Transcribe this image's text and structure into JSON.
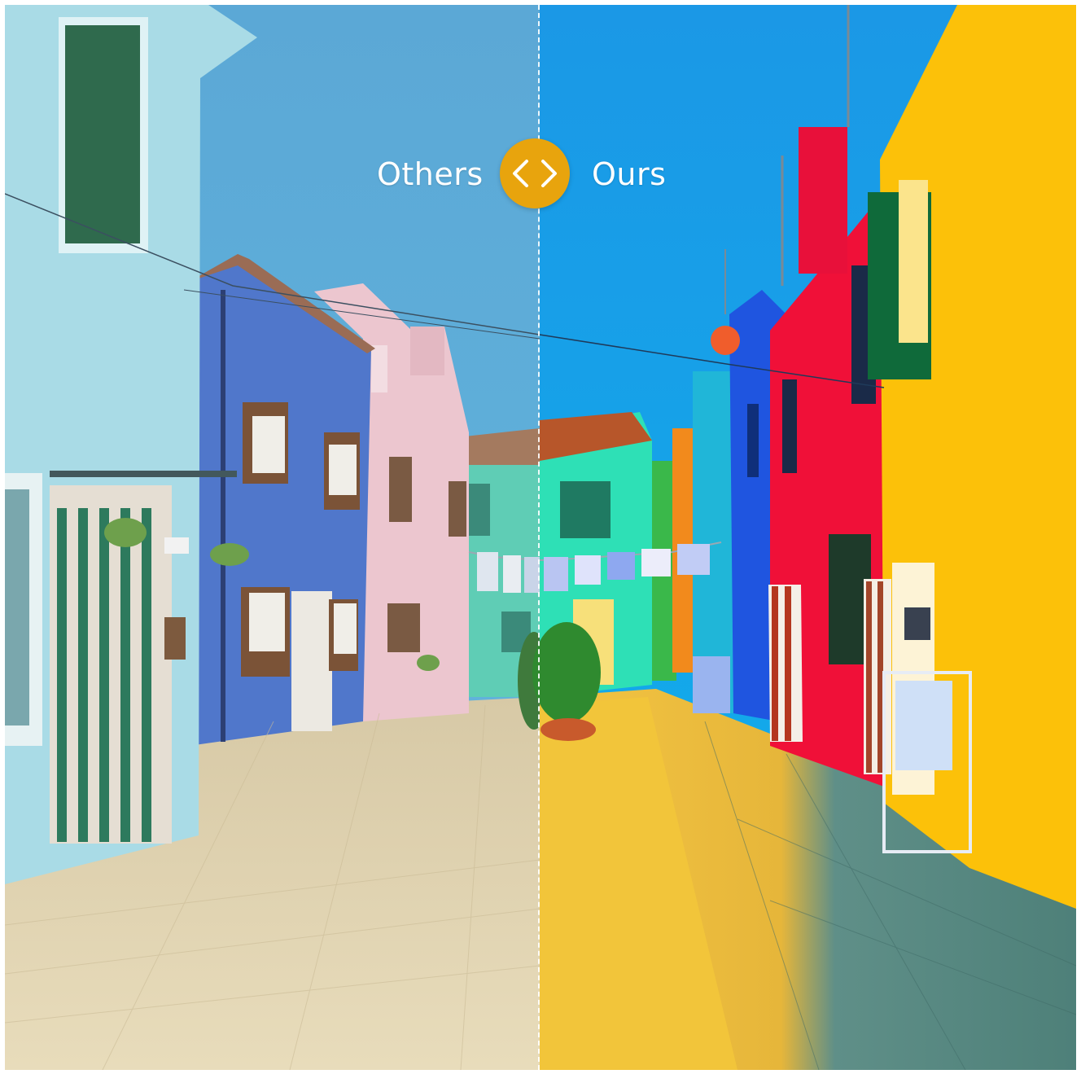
{
  "comparison": {
    "left_label": "Others",
    "right_label": "Ours"
  },
  "slider": {
    "icon": "compare-arrows-icon",
    "handle_color": "#e8a40d",
    "position_fraction": 0.5
  },
  "colors": {
    "sky_left": "#5aaed8",
    "sky_right": "#16a2ea",
    "house_yellow": "#f8c103",
    "house_red": "#f0143a",
    "house_blue_left": "#4f79d0",
    "house_teal": "#2fe0b8"
  }
}
